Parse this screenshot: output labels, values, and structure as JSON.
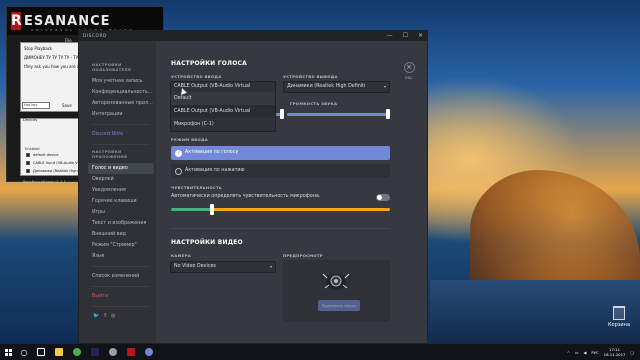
{
  "resanance": {
    "logo_letter": "R",
    "logo_text": "ESANANCE",
    "logo_sub": "UNIVERSAL SOUND BOARD",
    "file_menu": "File",
    "playback_lines": [
      "Stop Playback",
      "ДИМОНЕУ ТУ ТУ ТУ ТУ - ТУТУТУ",
      "they ask you how you are and you ju"
    ],
    "hotkey_value": "Hot key",
    "save_label": "Save",
    "devices_title": "Devices",
    "devices_header": "Enabled",
    "devices": [
      {
        "name": "default device",
        "checked": true
      },
      {
        "name": "CABLE Input (VB-Audio V",
        "checked": true
      },
      {
        "name": "Динамики (Realtek High",
        "checked": true
      }
    ],
    "footer": "ResaNanceBoard v1.1.1"
  },
  "discord": {
    "window_title": "DISCORD",
    "window_controls": [
      "—",
      "☐",
      "✕"
    ],
    "sidebar": {
      "user_settings_header": "НАСТРОЙКИ ПОЛЬЗОВАТЕЛЯ",
      "user_items": [
        "Моя учетная запись",
        "Конфиденциальность...",
        "Авторизованные прил...",
        "Интеграции"
      ],
      "nitro": "Discord Nitro",
      "app_settings_header": "НАСТРОЙКИ ПРИЛОЖЕНИЯ",
      "app_items": [
        "Голос и видео",
        "Оверлей",
        "Уведомления",
        "Горячие клавиши",
        "Игры",
        "Текст и изображения",
        "Внешний вид",
        "Режим \"Стример\"",
        "Язык"
      ],
      "active_item": "Голос и видео",
      "changelog": "Список изменений",
      "logout": "Выйти",
      "social": [
        "🐦",
        "f",
        "◎"
      ]
    },
    "esc_label": "ESC",
    "voice_settings_title": "НАСТРОЙКИ ГОЛОСА",
    "input_device_label": "УСТРОЙСТВО ВВОДА",
    "input_device_value": "CABLE Output (VB-Audio Virtual",
    "input_device_options": [
      "Default",
      "CABLE Output (VB-Audio Virtual",
      "Микрофон (C-1)"
    ],
    "input_selected_index": 1,
    "output_device_label": "УСТРОЙСТВО ВЫВОДА",
    "output_device_value": "Динамики (Realtek High Definiti",
    "output_volume_label": "ГРОМКОСТЬ ЗВУКА",
    "input_volume_level": 1.0,
    "output_volume_level": 1.0,
    "input_mode_label": "РЕЖИМ ВВОДА",
    "mode_voice_activity": "Активация по голосу",
    "mode_push_to_talk": "Активация по нажатию",
    "mode_selected": "voice",
    "sensitivity_label": "ЧУВСТВИТЕЛЬНОСТЬ",
    "auto_sensitivity_text": "Автоматически определять чувствительность микрофона.",
    "auto_sensitivity_on": false,
    "sensitivity_level": 0.18,
    "video_settings_title": "НАСТРОЙКИ ВИДЕО",
    "camera_label": "КАМЕРА",
    "camera_value": "No Video Devices",
    "preview_label": "ПРЕДПРОСМОТР",
    "preview_button": "Проверить видео"
  },
  "desktop": {
    "recycle_bin": "Корзина"
  },
  "taskbar": {
    "apps": [
      {
        "name": "task-view",
        "color": "#ffffff"
      },
      {
        "name": "explorer",
        "color": "#f2c94c"
      },
      {
        "name": "chrome",
        "color": "#4caf50"
      },
      {
        "name": "premiere",
        "color": "#2b1f5a"
      },
      {
        "name": "settings",
        "color": "#9e9e9e"
      },
      {
        "name": "resanance",
        "color": "#b3171a"
      },
      {
        "name": "discord",
        "color": "#7289da"
      }
    ],
    "lang": "РУС",
    "time": "17:11",
    "date": "16.11.2017"
  },
  "colors": {
    "discord_accent": "#7289da",
    "discord_bg": "#36393f",
    "discord_sidebar": "#2f3136",
    "logout_red": "#f04747"
  }
}
